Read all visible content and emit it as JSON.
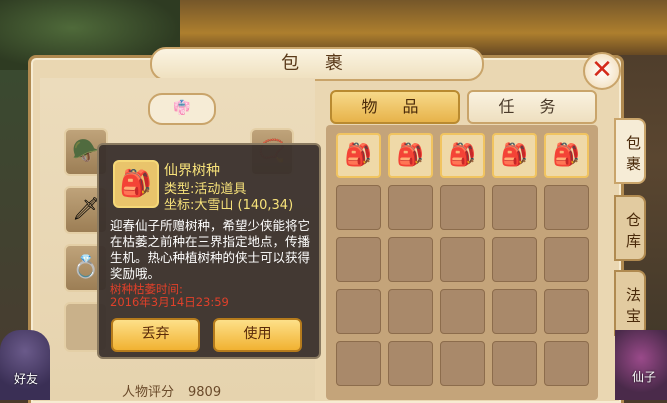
{
  "window": {
    "title": "包 裹",
    "close_symbol": "✕"
  },
  "character": {
    "outfit_icon": "robe-icon",
    "rating_label": "人物评分",
    "rating_value": "9809",
    "side_label": "好友"
  },
  "tooltip": {
    "item_name": "仙界树种",
    "item_type": "类型:活动道具",
    "coords": "坐标:大雪山 (140,34)",
    "description": "迎春仙子所赠树种，希望少侠能将它在枯萎之前种在三界指定地点，传播生机。热心种植树种的侠士可以获得奖励哦。",
    "expire_label": "树种枯萎时间:",
    "expire_time": "2016年3月14日23:59",
    "discard_label": "丢弃",
    "use_label": "使用"
  },
  "tabs": {
    "items_label": "物 品",
    "quests_label": "任 务"
  },
  "side_tabs": [
    "包裹",
    "仓库",
    "法宝"
  ],
  "right_label": "仙子",
  "grid": {
    "rows": 5,
    "cols": 5,
    "filled_count": 5
  }
}
